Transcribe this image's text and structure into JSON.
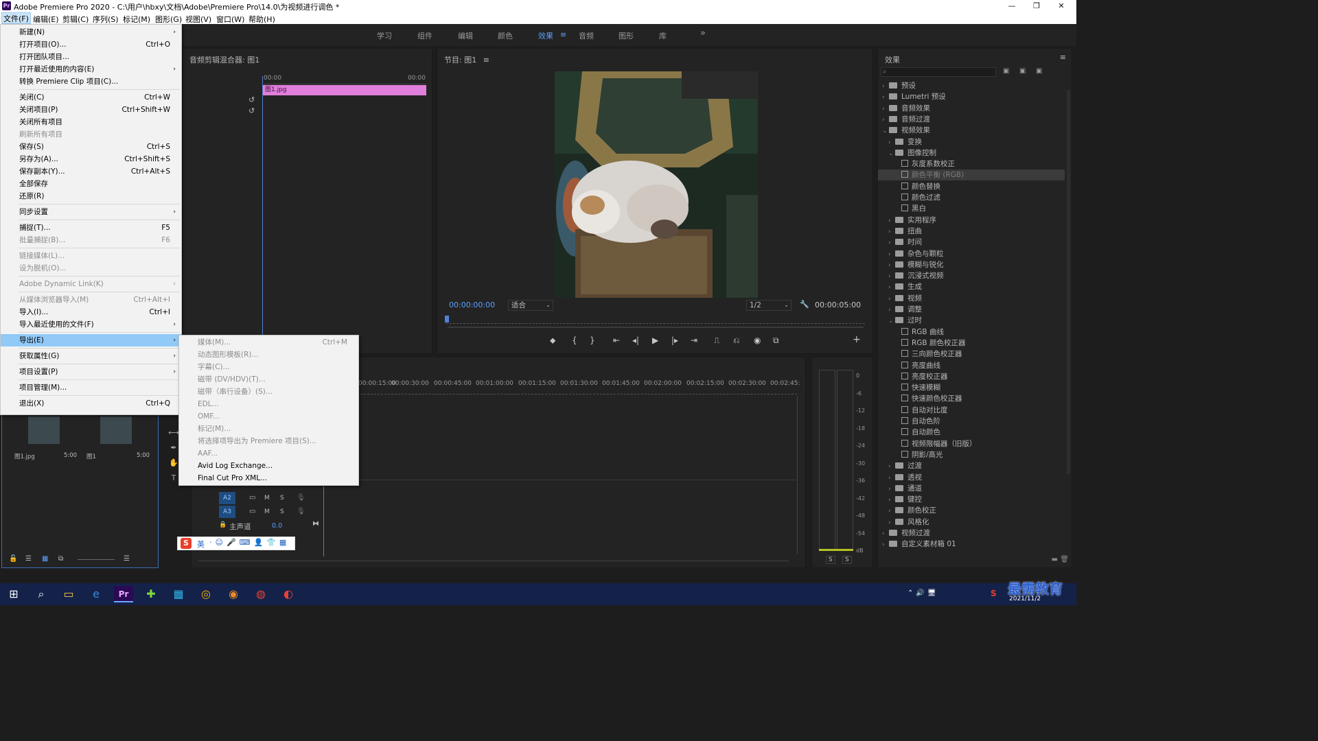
{
  "titlebar": {
    "title": "Adobe Premiere Pro 2020 - C:\\用户\\hbxy\\文档\\Adobe\\Premiere Pro\\14.0\\为视频进行调色 *",
    "minimize": "—",
    "maximize": "❐",
    "close": "✕"
  },
  "menubar": [
    "文件(F)",
    "编辑(E)",
    "剪辑(C)",
    "序列(S)",
    "标记(M)",
    "图形(G)",
    "视图(V)",
    "窗口(W)",
    "帮助(H)"
  ],
  "workspaces": [
    "学习",
    "组件",
    "编辑",
    "颜色",
    "效果",
    "音频",
    "图形",
    "库"
  ],
  "workspace_active": "效果",
  "source_panel": {
    "title": "音频剪辑混合器: 图1",
    "t_start": "00:00",
    "t_end": "00:00",
    "clip": "图1.jpg"
  },
  "program": {
    "title": "节目: 图1",
    "timecode": "00:00:00:00",
    "fit": "适合",
    "resolution": "1/2",
    "duration": "00:00:05:00"
  },
  "effects": {
    "title": "效果",
    "tree": [
      {
        "label": "预设",
        "level": 0,
        "kind": "folder",
        "open": false
      },
      {
        "label": "Lumetri 预设",
        "level": 0,
        "kind": "folder",
        "open": false
      },
      {
        "label": "音频效果",
        "level": 0,
        "kind": "folder",
        "open": false
      },
      {
        "label": "音频过渡",
        "level": 0,
        "kind": "folder",
        "open": false
      },
      {
        "label": "视频效果",
        "level": 0,
        "kind": "folder",
        "open": true
      },
      {
        "label": "变换",
        "level": 1,
        "kind": "folder",
        "open": false
      },
      {
        "label": "图像控制",
        "level": 1,
        "kind": "folder",
        "open": true
      },
      {
        "label": "灰度系数校正",
        "level": 2,
        "kind": "fx"
      },
      {
        "label": "颜色平衡 (RGB)",
        "level": 2,
        "kind": "fx",
        "selected": true
      },
      {
        "label": "颜色替换",
        "level": 2,
        "kind": "fx"
      },
      {
        "label": "颜色过滤",
        "level": 2,
        "kind": "fx"
      },
      {
        "label": "黑白",
        "level": 2,
        "kind": "fx"
      },
      {
        "label": "实用程序",
        "level": 1,
        "kind": "folder",
        "open": false
      },
      {
        "label": "扭曲",
        "level": 1,
        "kind": "folder",
        "open": false
      },
      {
        "label": "时间",
        "level": 1,
        "kind": "folder",
        "open": false
      },
      {
        "label": "杂色与颗粒",
        "level": 1,
        "kind": "folder",
        "open": false
      },
      {
        "label": "模糊与锐化",
        "level": 1,
        "kind": "folder",
        "open": false
      },
      {
        "label": "沉浸式视频",
        "level": 1,
        "kind": "folder",
        "open": false
      },
      {
        "label": "生成",
        "level": 1,
        "kind": "folder",
        "open": false
      },
      {
        "label": "视频",
        "level": 1,
        "kind": "folder",
        "open": false
      },
      {
        "label": "调整",
        "level": 1,
        "kind": "folder",
        "open": false
      },
      {
        "label": "过时",
        "level": 1,
        "kind": "folder",
        "open": true
      },
      {
        "label": "RGB 曲线",
        "level": 2,
        "kind": "fx"
      },
      {
        "label": "RGB 颜色校正器",
        "level": 2,
        "kind": "fx"
      },
      {
        "label": "三向颜色校正器",
        "level": 2,
        "kind": "fx"
      },
      {
        "label": "亮度曲线",
        "level": 2,
        "kind": "fx"
      },
      {
        "label": "亮度校正器",
        "level": 2,
        "kind": "fx"
      },
      {
        "label": "快速模糊",
        "level": 2,
        "kind": "fx"
      },
      {
        "label": "快速颜色校正器",
        "level": 2,
        "kind": "fx"
      },
      {
        "label": "自动对比度",
        "level": 2,
        "kind": "fx"
      },
      {
        "label": "自动色阶",
        "level": 2,
        "kind": "fx"
      },
      {
        "label": "自动颜色",
        "level": 2,
        "kind": "fx"
      },
      {
        "label": "视频限幅器（旧版）",
        "level": 2,
        "kind": "fx"
      },
      {
        "label": "阴影/高光",
        "level": 2,
        "kind": "fx"
      },
      {
        "label": "过渡",
        "level": 1,
        "kind": "folder",
        "open": false
      },
      {
        "label": "透视",
        "level": 1,
        "kind": "folder",
        "open": false
      },
      {
        "label": "通道",
        "level": 1,
        "kind": "folder",
        "open": false
      },
      {
        "label": "键控",
        "level": 1,
        "kind": "folder",
        "open": false
      },
      {
        "label": "颜色校正",
        "level": 1,
        "kind": "folder",
        "open": false
      },
      {
        "label": "风格化",
        "level": 1,
        "kind": "folder",
        "open": false
      },
      {
        "label": "视频过渡",
        "level": 0,
        "kind": "folder",
        "open": false
      },
      {
        "label": "自定义素材箱 01",
        "level": 0,
        "kind": "folder",
        "open": false
      }
    ]
  },
  "file_menu": [
    {
      "label": "新建(N)",
      "shortcut": "",
      "submenu": true
    },
    {
      "label": "打开项目(O)...",
      "shortcut": "Ctrl+O"
    },
    {
      "label": "打开团队项目..."
    },
    {
      "label": "打开最近使用的内容(E)",
      "submenu": true
    },
    {
      "label": "转换 Premiere Clip 项目(C)..."
    },
    {
      "sep": true
    },
    {
      "label": "关闭(C)",
      "shortcut": "Ctrl+W"
    },
    {
      "label": "关闭项目(P)",
      "shortcut": "Ctrl+Shift+W"
    },
    {
      "label": "关闭所有项目"
    },
    {
      "label": "刷新所有项目",
      "disabled": true
    },
    {
      "label": "保存(S)",
      "shortcut": "Ctrl+S"
    },
    {
      "label": "另存为(A)...",
      "shortcut": "Ctrl+Shift+S"
    },
    {
      "label": "保存副本(Y)...",
      "shortcut": "Ctrl+Alt+S"
    },
    {
      "label": "全部保存"
    },
    {
      "label": "还原(R)"
    },
    {
      "sep": true
    },
    {
      "label": "同步设置",
      "submenu": true
    },
    {
      "sep": true
    },
    {
      "label": "捕捉(T)...",
      "shortcut": "F5"
    },
    {
      "label": "批量捕捉(B)...",
      "shortcut": "F6",
      "disabled": true
    },
    {
      "sep": true
    },
    {
      "label": "链接媒体(L)...",
      "disabled": true
    },
    {
      "label": "设为脱机(O)...",
      "disabled": true
    },
    {
      "sep": true
    },
    {
      "label": "Adobe Dynamic Link(K)",
      "submenu": true,
      "disabled": true
    },
    {
      "sep": true
    },
    {
      "label": "从媒体浏览器导入(M)",
      "shortcut": "Ctrl+Alt+I",
      "disabled": true
    },
    {
      "label": "导入(I)...",
      "shortcut": "Ctrl+I"
    },
    {
      "label": "导入最近使用的文件(F)",
      "submenu": true
    },
    {
      "sep": true
    },
    {
      "label": "导出(E)",
      "submenu": true,
      "highlight": true
    },
    {
      "sep": true
    },
    {
      "label": "获取属性(G)",
      "submenu": true
    },
    {
      "sep": true
    },
    {
      "label": "项目设置(P)",
      "submenu": true
    },
    {
      "sep": true
    },
    {
      "label": "项目管理(M)..."
    },
    {
      "sep": true
    },
    {
      "label": "退出(X)",
      "shortcut": "Ctrl+Q"
    }
  ],
  "export_menu": [
    {
      "label": "媒体(M)...",
      "shortcut": "Ctrl+M",
      "disabled": true
    },
    {
      "label": "动态图形模板(R)...",
      "disabled": true
    },
    {
      "label": "字幕(C)...",
      "disabled": true
    },
    {
      "label": "磁带 (DV/HDV)(T)...",
      "disabled": true
    },
    {
      "label": "磁带（串行设备）(S)...",
      "disabled": true
    },
    {
      "label": "EDL...",
      "disabled": true
    },
    {
      "label": "OMF...",
      "disabled": true
    },
    {
      "label": "标记(M)...",
      "disabled": true
    },
    {
      "label": "将选择项导出为 Premiere 项目(S)...",
      "disabled": true
    },
    {
      "label": "AAF...",
      "disabled": true
    },
    {
      "label": "Avid Log Exchange..."
    },
    {
      "label": "Final Cut Pro XML..."
    }
  ],
  "timeline": {
    "ruler": [
      "00:00:15:00",
      "00:00:30:00",
      "00:00:45:00",
      "00:01:00:00",
      "00:01:15:00",
      "00:01:30:00",
      "00:01:45:00",
      "00:02:00:00",
      "00:02:15:00",
      "00:02:30:00",
      "00:02:45:"
    ],
    "tracks": [
      "A2",
      "A3"
    ],
    "track_m": "M",
    "track_s": "S",
    "master_label": "主声道",
    "master_value": "0.0"
  },
  "project": {
    "items": [
      {
        "name": "图1.jpg",
        "dur": "5:00"
      },
      {
        "name": "图1",
        "dur": "5:00"
      }
    ]
  },
  "meters": {
    "scale": [
      "0",
      "-6",
      "-12",
      "-18",
      "-24",
      "-30",
      "-36",
      "-42",
      "-48",
      "-54",
      "dB"
    ],
    "solo": "S"
  },
  "ime": {
    "lang": "英"
  },
  "tray": {
    "date": "2021/11/2",
    "watermark": "最需教育"
  },
  "accent": "#5aa0ff",
  "clip_color": "#e07fdb"
}
